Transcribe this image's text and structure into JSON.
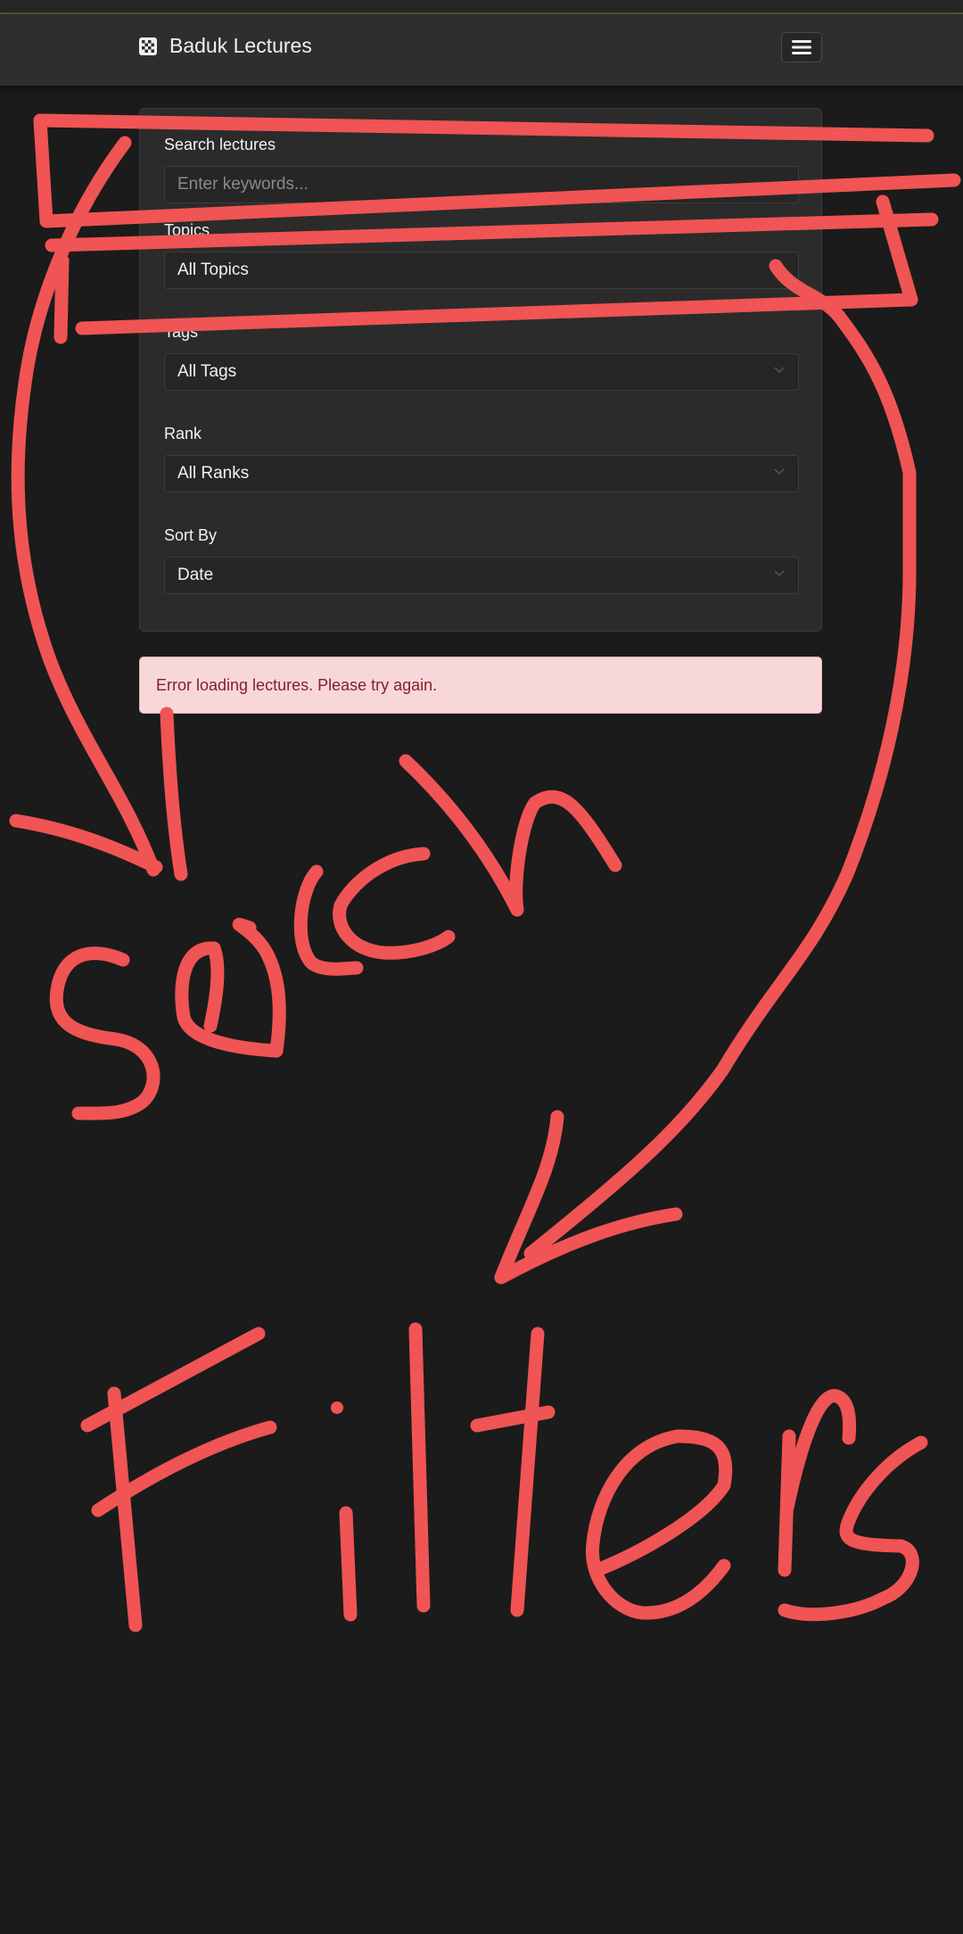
{
  "navbar": {
    "brand": "Baduk Lectures",
    "brand_icon": "board-grid-icon",
    "menu_icon": "hamburger-menu-icon"
  },
  "filters": {
    "search_label": "Search lectures",
    "search_placeholder": "Enter keywords...",
    "topics_label": "Topics",
    "topics_value": "All Topics",
    "tags_label": "Tags",
    "tags_value": "All Tags",
    "rank_label": "Rank",
    "rank_value": "All Ranks",
    "sort_label": "Sort By",
    "sort_value": "Date"
  },
  "alert": {
    "message": "Error loading lectures. Please try again."
  },
  "annotation": {
    "color": "#f05454",
    "words": [
      "Serch",
      "Filters"
    ]
  }
}
